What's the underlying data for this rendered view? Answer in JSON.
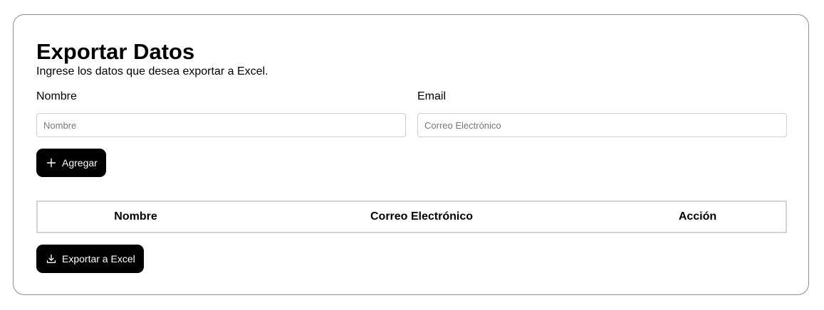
{
  "header": {
    "title": "Exportar Datos",
    "subtitle": "Ingrese los datos que desea exportar a Excel."
  },
  "form": {
    "name_label": "Nombre",
    "name_placeholder": "Nombre",
    "email_label": "Email",
    "email_placeholder": "Correo Electrónico",
    "add_button_label": "Agregar",
    "add_button_icon": "plus-icon"
  },
  "table": {
    "columns": [
      "Nombre",
      "Correo Electrónico",
      "Acción"
    ],
    "rows": []
  },
  "export": {
    "button_label": "Exportar a Excel",
    "button_icon": "download-icon"
  }
}
